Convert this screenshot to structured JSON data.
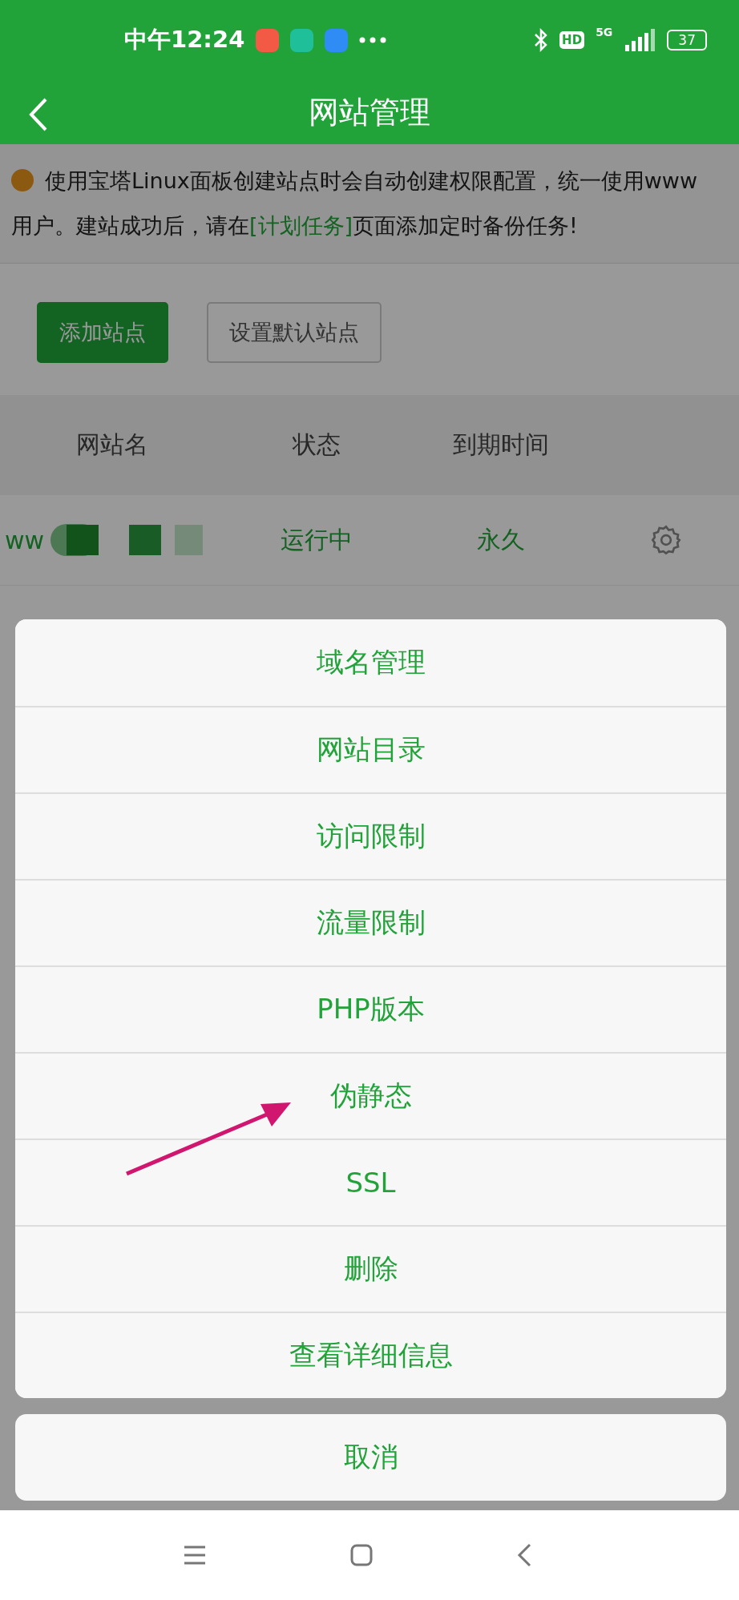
{
  "status_bar": {
    "time": "中午12:24",
    "network": "5G",
    "hd": "HD",
    "battery": "37"
  },
  "header": {
    "title": "网站管理"
  },
  "notice": {
    "before": "使用宝塔Linux面板创建站点时会自动创建权限配置，统一使用www用户。建站成功后，请在",
    "link": "[计划任务]",
    "after": "页面添加定时备份任务!"
  },
  "buttons": [
    {
      "label": "添加站点",
      "kind": "primary"
    },
    {
      "label": "设置默认站点",
      "kind": "default"
    }
  ],
  "table": {
    "columns": [
      "网站名",
      "状态",
      "到期时间"
    ],
    "rows": [
      {
        "name": "ww",
        "status": "运行中",
        "expiry": "永久"
      }
    ]
  },
  "action_sheet": {
    "items": [
      "域名管理",
      "网站目录",
      "访问限制",
      "流量限制",
      "PHP版本",
      "伪静态",
      "SSL",
      "删除",
      "查看详细信息"
    ],
    "cancel": "取消"
  }
}
